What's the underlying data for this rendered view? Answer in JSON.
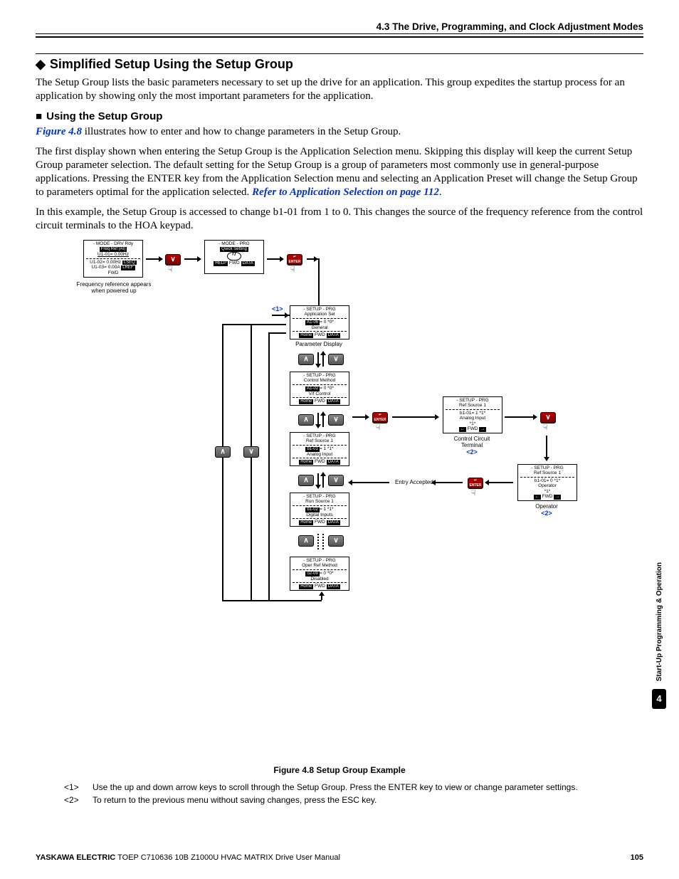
{
  "header": {
    "section_number": "4.3",
    "section_title": "The Drive, Programming, and Clock Adjustment Modes"
  },
  "h2": "Simplified Setup Using the Setup Group",
  "p1": "The Setup Group lists the basic parameters necessary to set up the drive for an application. This group expedites the startup process for an application by showing only the most important parameters for the application.",
  "h3": "Using the Setup Group",
  "p2a": "Figure 4.8",
  "p2b": " illustrates how to enter and how to change parameters in the Setup Group.",
  "p3a": "The first display shown when entering the Setup Group is the Application Selection menu. Skipping this display will keep the current Setup Group parameter selection. The default setting for the Setup Group is a group of parameters most commonly use in general-purpose applications. Pressing the ENTER key from the Application Selection menu and selecting an Application Preset will change the Setup Group to parameters optimal for the application selected. ",
  "p3b": "Refer to Application Selection on page 112",
  "p3c": ".",
  "p4": "In this example, the Setup Group is accessed to change b1-01 from 1 to 0. This changes the source of the frequency reference from the control circuit terminals to the HOA keypad.",
  "diagram": {
    "lcd_freq": {
      "l1": "- MODE -    DRV  Rdy",
      "l2": "Freq Ref (AI)",
      "l3": "U1-01= 0.00Hz",
      "l4a": "U1-02= 0.00Hz",
      "l4b": "LSEQ",
      "l5a": "U1-03= 0.00A",
      "l5b": "LREF",
      "fwd": "FWD",
      "sub": "Frequency reference appears when powered up"
    },
    "lcd_quick": {
      "l1": "- MODE -         PRG",
      "l2": "Quick Setting",
      "help": "HELP",
      "fwd": "FWD",
      "data": "DATA"
    },
    "lcd_app": {
      "l1": "- SETUP -        PRG",
      "l2": "Application Sel",
      "l3a": "A1-06",
      "l3b": "= 0 *0*",
      "l4": "General",
      "home": "Home",
      "fwd": "FWD",
      "data": "DATA",
      "sub": "Parameter Display",
      "tag": "<1>"
    },
    "lcd_ctrl": {
      "l1": "- SETUP -        PRG",
      "l2": "Control Method",
      "l3a": "A1-02",
      "l3b": "= 0 *0*",
      "l4": "V/f Control",
      "home": "Home",
      "fwd": "FWD",
      "data": "DATA"
    },
    "lcd_ref": {
      "l1": "- SETUP -        PRG",
      "l2": "Ref Source 1",
      "l3a": "b1-01",
      "l3b": "= 1 *1*",
      "l4": "Analog Input",
      "home": "Home",
      "fwd": "FWD",
      "data": "DATA"
    },
    "lcd_run": {
      "l1": "- SETUP -        PRG",
      "l2": "Run Source 1",
      "l3a": "b1-02",
      "l3b": "= 1 *1*",
      "l4": "Digital Inputs",
      "home": "Home",
      "fwd": "FWD",
      "data": "DATA"
    },
    "lcd_oper": {
      "l1": "- SETUP -        PRG",
      "l2": "Oper Ref Method",
      "l3a": "o2-09",
      "l3b": "= 0 *0*",
      "l4": "Disabled",
      "home": "Home",
      "fwd": "FWD",
      "data": "DATA"
    },
    "lcd_refedit1": {
      "l1": "- SETUP -        PRG",
      "l2": "Ref Source 1",
      "l3": "b1-01= 1 *1*",
      "l4": "Analog Input",
      "l5": "*1*",
      "fwd": "FWD",
      "sub": "Control Circuit Terminal",
      "tag": "<2>"
    },
    "lcd_refedit2": {
      "l1": "- SETUP -        PRG",
      "l2": "Ref Source 1",
      "l3": "b1-01= 0 *1*",
      "l4": "Operator",
      "l5": "*1*",
      "fwd": "FWD",
      "sub": "Operator",
      "tag": "<2>"
    },
    "entry_accepted": "Entry Accepted"
  },
  "figure_caption": "Figure 4.8  Setup Group Example",
  "notes": {
    "n1_tag": "<1>",
    "n1": "Use the up and down arrow keys to scroll through the Setup Group. Press the ENTER key to view or change parameter settings.",
    "n2_tag": "<2>",
    "n2": "To return to the previous menu without saving changes, press the ESC key."
  },
  "side_tab": {
    "text": "Start-Up Programming & Operation",
    "num": "4"
  },
  "footer": {
    "brand": "YASKAWA ELECTRIC",
    "manual": " TOEP C710636 10B Z1000U HVAC MATRIX Drive User Manual",
    "page": "105"
  }
}
